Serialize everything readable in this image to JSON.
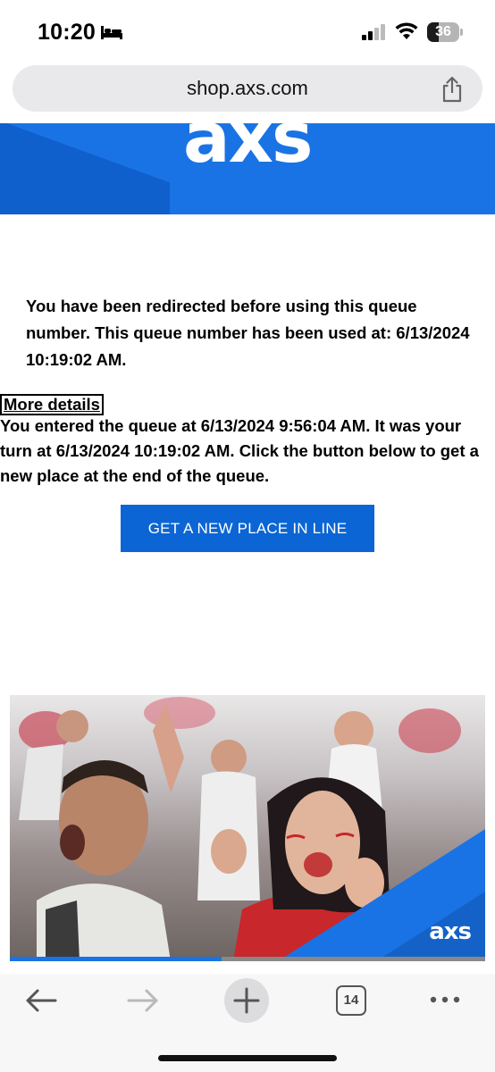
{
  "status_bar": {
    "time": "10:20",
    "battery_level": "36",
    "battery_fraction": 0.36
  },
  "browser": {
    "url": "shop.axs.com",
    "tab_count": "14"
  },
  "banner": {
    "logo": "axs"
  },
  "queue": {
    "message": "You have been redirected before using this queue number. This queue number has been used at: 6/13/2024 10:19:02 AM.",
    "details_link": "More details",
    "details_text": "You entered the queue at 6/13/2024 9:56:04 AM. It was your turn at 6/13/2024 10:19:02 AM. Click the button below to get a new place at the end of the queue.",
    "button_label": "GET A NEW PLACE IN LINE"
  },
  "hero": {
    "logo": "axs",
    "progress_fraction": 0.445
  },
  "icons": {
    "bed": "bed-icon",
    "signal": "cellular-signal-icon",
    "wifi": "wifi-icon",
    "share": "share-icon",
    "back": "arrow-left-icon",
    "forward": "arrow-right-icon",
    "new_tab": "plus-icon",
    "tabs": "tabs-icon",
    "more": "more-icon"
  },
  "colors": {
    "brand_blue": "#1a73e4",
    "button_blue": "#0b65d4"
  }
}
